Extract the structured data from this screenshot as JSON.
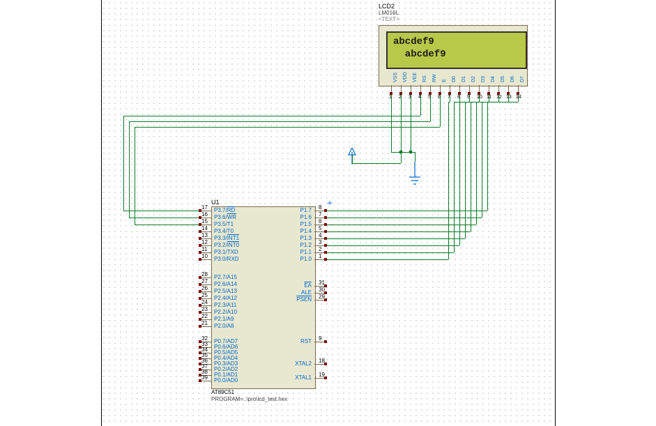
{
  "lcd": {
    "ref": "LCD2",
    "part": "LM016L",
    "text_prop": "<TEXT>",
    "line1": "abcdef9",
    "line2": "  abcdef9",
    "pins": [
      "VSS",
      "VDD",
      "VEE",
      "RS",
      "RW",
      "E",
      "D0",
      "D1",
      "D2",
      "D3",
      "D4",
      "D5",
      "D6",
      "D7"
    ],
    "pinnums": [
      "1",
      "2",
      "3",
      "4",
      "5",
      "6",
      "7",
      "8",
      "9",
      "10",
      "11",
      "12",
      "13",
      "14"
    ]
  },
  "mcu": {
    "ref": "U1",
    "part": "AT89C51",
    "prog": "PROGRAM=..\\pro\\lcd_test.hex",
    "left_p3": [
      {
        "num": "17",
        "name": "P3.7/RD",
        "ov": "RD"
      },
      {
        "num": "16",
        "name": "P3.6/WR",
        "ov": "WR"
      },
      {
        "num": "15",
        "name": "P3.5/T1"
      },
      {
        "num": "14",
        "name": "P3.4/T0"
      },
      {
        "num": "13",
        "name": "P3.3/INT1",
        "ov": "INT1"
      },
      {
        "num": "12",
        "name": "P3.2/INT0",
        "ov": "INT0"
      },
      {
        "num": "11",
        "name": "P3.1/TXD"
      },
      {
        "num": "10",
        "name": "P3.0/RXD"
      }
    ],
    "left_p2": [
      {
        "num": "28",
        "name": "P2.7/A15"
      },
      {
        "num": "27",
        "name": "P2.6/A14"
      },
      {
        "num": "26",
        "name": "P2.5/A13"
      },
      {
        "num": "25",
        "name": "P2.4/A12"
      },
      {
        "num": "24",
        "name": "P2.3/A11"
      },
      {
        "num": "23",
        "name": "P2.2/A10"
      },
      {
        "num": "22",
        "name": "P2.1/A9"
      },
      {
        "num": "21",
        "name": "P2.0/A8"
      }
    ],
    "left_p0": [
      {
        "num": "32",
        "name": "P0.7/AD7"
      },
      {
        "num": "33",
        "name": "P0.6/AD6"
      },
      {
        "num": "34",
        "name": "P0.5/AD5"
      },
      {
        "num": "35",
        "name": "P0.4/AD4"
      },
      {
        "num": "36",
        "name": "P0.3/AD3"
      },
      {
        "num": "37",
        "name": "P0.2/AD2"
      },
      {
        "num": "38",
        "name": "P0.1/AD1"
      },
      {
        "num": "39",
        "name": "P0.0/AD0"
      }
    ],
    "right_p1": [
      {
        "num": "8",
        "name": "P1.7"
      },
      {
        "num": "7",
        "name": "P1.6"
      },
      {
        "num": "6",
        "name": "P1.5"
      },
      {
        "num": "5",
        "name": "P1.4"
      },
      {
        "num": "4",
        "name": "P1.3"
      },
      {
        "num": "3",
        "name": "P1.2"
      },
      {
        "num": "2",
        "name": "P1.1"
      },
      {
        "num": "1",
        "name": "P1.0"
      }
    ],
    "right_ctrl": [
      {
        "num": "31",
        "name": "EA",
        "ov": "EA"
      },
      {
        "num": "30",
        "name": "ALE"
      },
      {
        "num": "29",
        "name": "PSEN",
        "ov": "PSEN"
      }
    ],
    "right_rst": {
      "num": "9",
      "name": "RST"
    },
    "right_xtal": [
      {
        "num": "18",
        "name": "XTAL2"
      },
      {
        "num": "19",
        "name": "XTAL1"
      }
    ]
  }
}
